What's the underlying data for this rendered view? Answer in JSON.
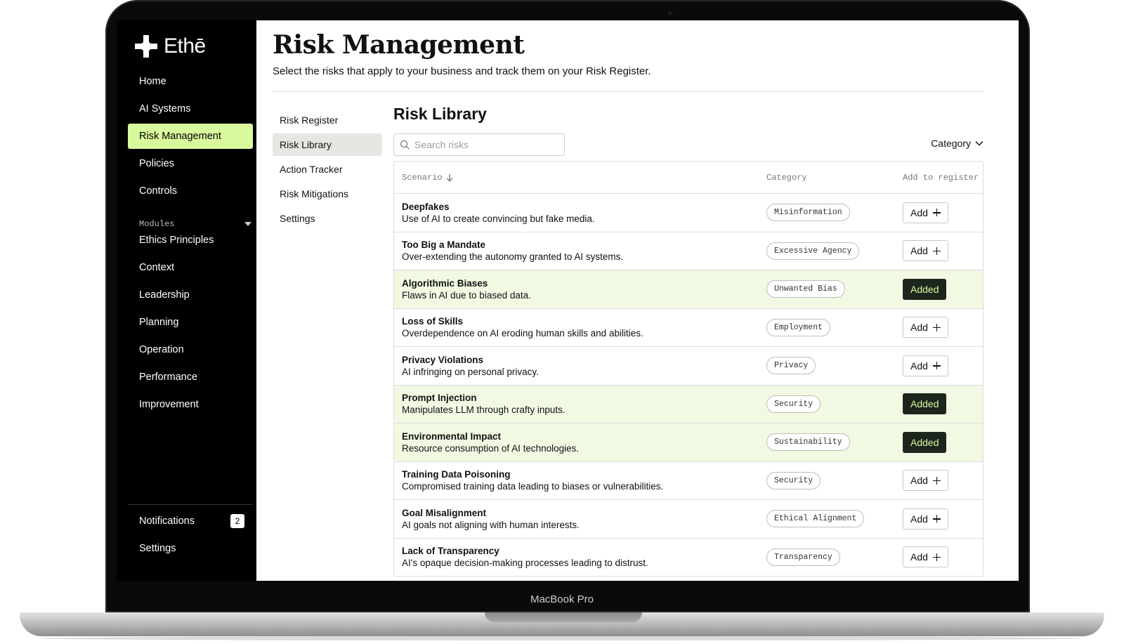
{
  "device": {
    "label": "MacBook Pro"
  },
  "brand": {
    "name": "Ethē"
  },
  "nav": {
    "items": [
      {
        "label": "Home"
      },
      {
        "label": "AI Systems"
      },
      {
        "label": "Risk Management",
        "active": true
      },
      {
        "label": "Policies"
      },
      {
        "label": "Controls"
      }
    ],
    "modules_label": "Modules",
    "module_items": [
      {
        "label": "Ethics Principles"
      },
      {
        "label": "Context"
      },
      {
        "label": "Leadership"
      },
      {
        "label": "Planning"
      },
      {
        "label": "Operation"
      },
      {
        "label": "Performance"
      },
      {
        "label": "Improvement"
      }
    ],
    "notifications": {
      "label": "Notifications",
      "count": "2"
    },
    "settings_label": "Settings"
  },
  "page": {
    "title": "Risk Management",
    "subtitle": "Select the risks that apply to your business and track them on your Risk Register."
  },
  "sub_nav": [
    {
      "label": "Risk Register"
    },
    {
      "label": "Risk Library",
      "active": true
    },
    {
      "label": "Action Tracker"
    },
    {
      "label": "Risk Mitigations"
    },
    {
      "label": "Settings"
    }
  ],
  "library": {
    "title": "Risk Library",
    "search_placeholder": "Search risks",
    "filter_label": "Category",
    "columns": {
      "scenario": "Scenario",
      "category": "Category",
      "add": "Add to register"
    },
    "add_label": "Add",
    "added_label": "Added",
    "rows": [
      {
        "title": "Deepfakes",
        "desc": "Use of AI to create convincing but fake media.",
        "category": "Misinformation",
        "added": false
      },
      {
        "title": "Too Big a Mandate",
        "desc": "Over-extending the autonomy granted to AI systems.",
        "category": "Excessive Agency",
        "added": false
      },
      {
        "title": "Algorithmic Biases",
        "desc": "Flaws in AI due to biased data.",
        "category": "Unwanted Bias",
        "added": true
      },
      {
        "title": "Loss of Skills",
        "desc": "Overdependence on AI eroding human skills and abilities.",
        "category": "Employment",
        "added": false
      },
      {
        "title": "Privacy Violations",
        "desc": "AI infringing on personal privacy.",
        "category": "Privacy",
        "added": false
      },
      {
        "title": "Prompt Injection",
        "desc": "Manipulates LLM through crafty inputs.",
        "category": "Security",
        "added": true
      },
      {
        "title": "Environmental Impact",
        "desc": "Resource consumption of AI technologies.",
        "category": "Sustainability",
        "added": true
      },
      {
        "title": "Training Data Poisoning",
        "desc": "Compromised training data leading to biases or vulnerabilities.",
        "category": "Security",
        "added": false
      },
      {
        "title": "Goal Misalignment",
        "desc": "AI goals not aligning with human interests.",
        "category": "Ethical Alignment",
        "added": false
      },
      {
        "title": "Lack of Transparency",
        "desc": "AI's opaque decision-making processes leading to distrust.",
        "category": "Transparency",
        "added": false
      }
    ]
  }
}
